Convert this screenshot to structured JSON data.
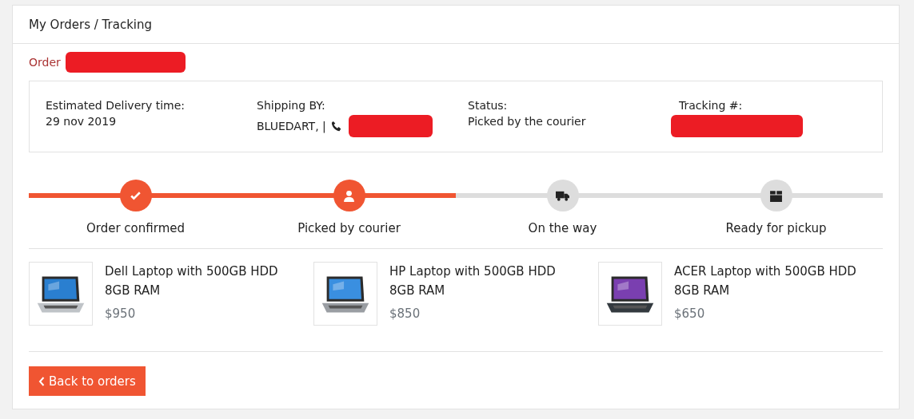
{
  "header": {
    "breadcrumb": "My Orders / Tracking"
  },
  "order": {
    "label": "Order",
    "redacted": true
  },
  "info": [
    {
      "label": "Estimated Delivery time:",
      "value": "29 nov 2019",
      "kind": "text"
    },
    {
      "label": "Shipping BY:",
      "value": "BLUEDART, |",
      "kind": "phone"
    },
    {
      "label": "Status:",
      "value": "Picked by the courier",
      "kind": "text"
    },
    {
      "label": "Tracking #:",
      "kind": "redacted"
    }
  ],
  "progress": {
    "level": 0.5
  },
  "steps": [
    {
      "label": "Order confirmed",
      "kind": "check",
      "active": true
    },
    {
      "label": "Picked by courier",
      "kind": "user",
      "active": true
    },
    {
      "label": "On the way",
      "kind": "truck",
      "active": false
    },
    {
      "label": "Ready for pickup",
      "kind": "box",
      "active": false
    }
  ],
  "products": [
    {
      "name": "Dell Laptop with 500GB HDD",
      "spec": "8GB RAM",
      "price": "$950",
      "kind": "picture"
    },
    {
      "name": "HP Laptop with 500GB HDD",
      "spec": "8GB RAM",
      "price": "$850",
      "kind": "picture"
    },
    {
      "name": "ACER Laptop with 500GB HDD",
      "spec": "8GB RAM",
      "price": "$650",
      "kind": "picture"
    }
  ],
  "back_button": {
    "label": "Back to orders"
  }
}
